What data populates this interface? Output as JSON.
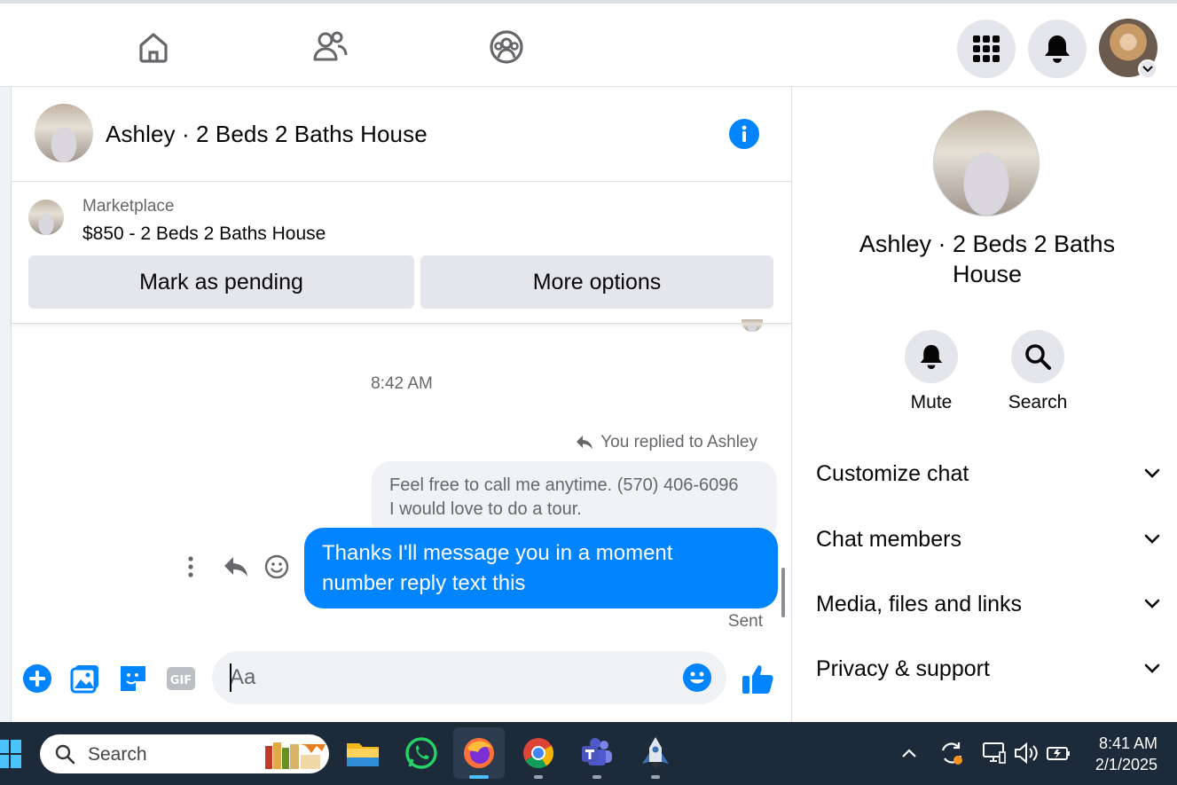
{
  "chat": {
    "title": "Ashley · 2 Beds 2 Baths House",
    "marketplace_label": "Marketplace",
    "listing": "$850 - 2 Beds 2 Baths House",
    "mark_pending_label": "Mark as pending",
    "more_options_label": "More options",
    "timestamp": "8:42 AM",
    "replied_label": "You replied to Ashley",
    "quoted_line1": "Feel free to call me anytime. (570) 406-6096",
    "quoted_line2": "I would love to do a tour.",
    "message_line1": "Thanks I'll message you in a moment",
    "message_line2": "number reply text this",
    "status": "Sent",
    "input_placeholder": "Aa"
  },
  "side": {
    "title": "Ashley · 2 Beds 2 Baths House",
    "mute_label": "Mute",
    "search_label": "Search",
    "sections": [
      "Customize chat",
      "Chat members",
      "Media, files and links",
      "Privacy & support"
    ]
  },
  "taskbar": {
    "search_placeholder": "Search",
    "time": "8:41 AM",
    "date": "2/1/2025"
  },
  "colors": {
    "accent": "#0084ff",
    "bubble_gray": "#f0f2f5",
    "button_gray": "#e4e6eb",
    "taskbar": "#1c2a3a"
  },
  "icons": {
    "nav": [
      "home-icon",
      "friends-icon",
      "groups-icon"
    ],
    "top_right": [
      "menu-grid-icon",
      "bell-icon",
      "profile-avatar"
    ],
    "composer": [
      "plus-icon",
      "photo-icon",
      "sticker-icon",
      "gif-icon",
      "emoji-icon",
      "like-icon"
    ],
    "message_actions": [
      "more-dots-icon",
      "reply-icon",
      "react-icon"
    ]
  }
}
